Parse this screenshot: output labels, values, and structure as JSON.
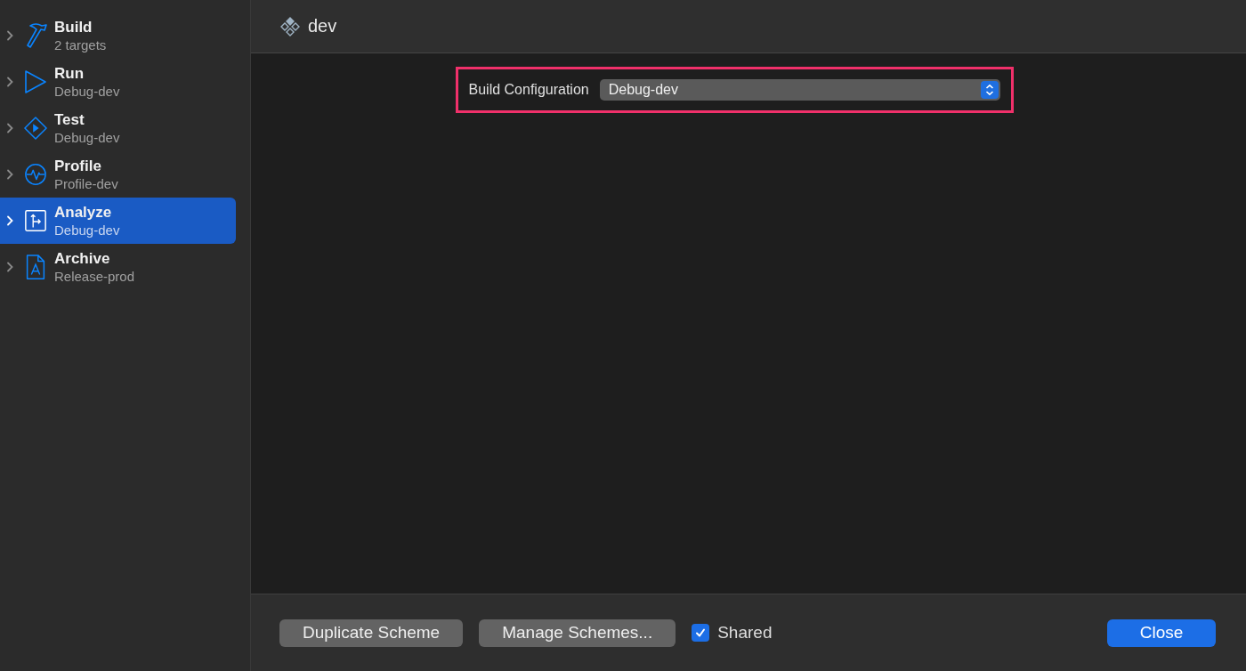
{
  "sidebar": {
    "items": [
      {
        "kind": "build",
        "title": "Build",
        "subtitle": "2 targets",
        "selected": false
      },
      {
        "kind": "run",
        "title": "Run",
        "subtitle": "Debug-dev",
        "selected": false
      },
      {
        "kind": "test",
        "title": "Test",
        "subtitle": "Debug-dev",
        "selected": false
      },
      {
        "kind": "profile",
        "title": "Profile",
        "subtitle": "Profile-dev",
        "selected": false
      },
      {
        "kind": "analyze",
        "title": "Analyze",
        "subtitle": "Debug-dev",
        "selected": true
      },
      {
        "kind": "archive",
        "title": "Archive",
        "subtitle": "Release-prod",
        "selected": false
      }
    ]
  },
  "header": {
    "title": "dev"
  },
  "build_configuration": {
    "label": "Build Configuration",
    "value": "Debug-dev",
    "highlighted": true
  },
  "footer": {
    "buttons": [
      {
        "label": "Duplicate Scheme"
      },
      {
        "label": "Manage Schemes..."
      }
    ],
    "shared": {
      "label": "Shared",
      "checked": true
    },
    "close": {
      "label": "Close"
    }
  }
}
